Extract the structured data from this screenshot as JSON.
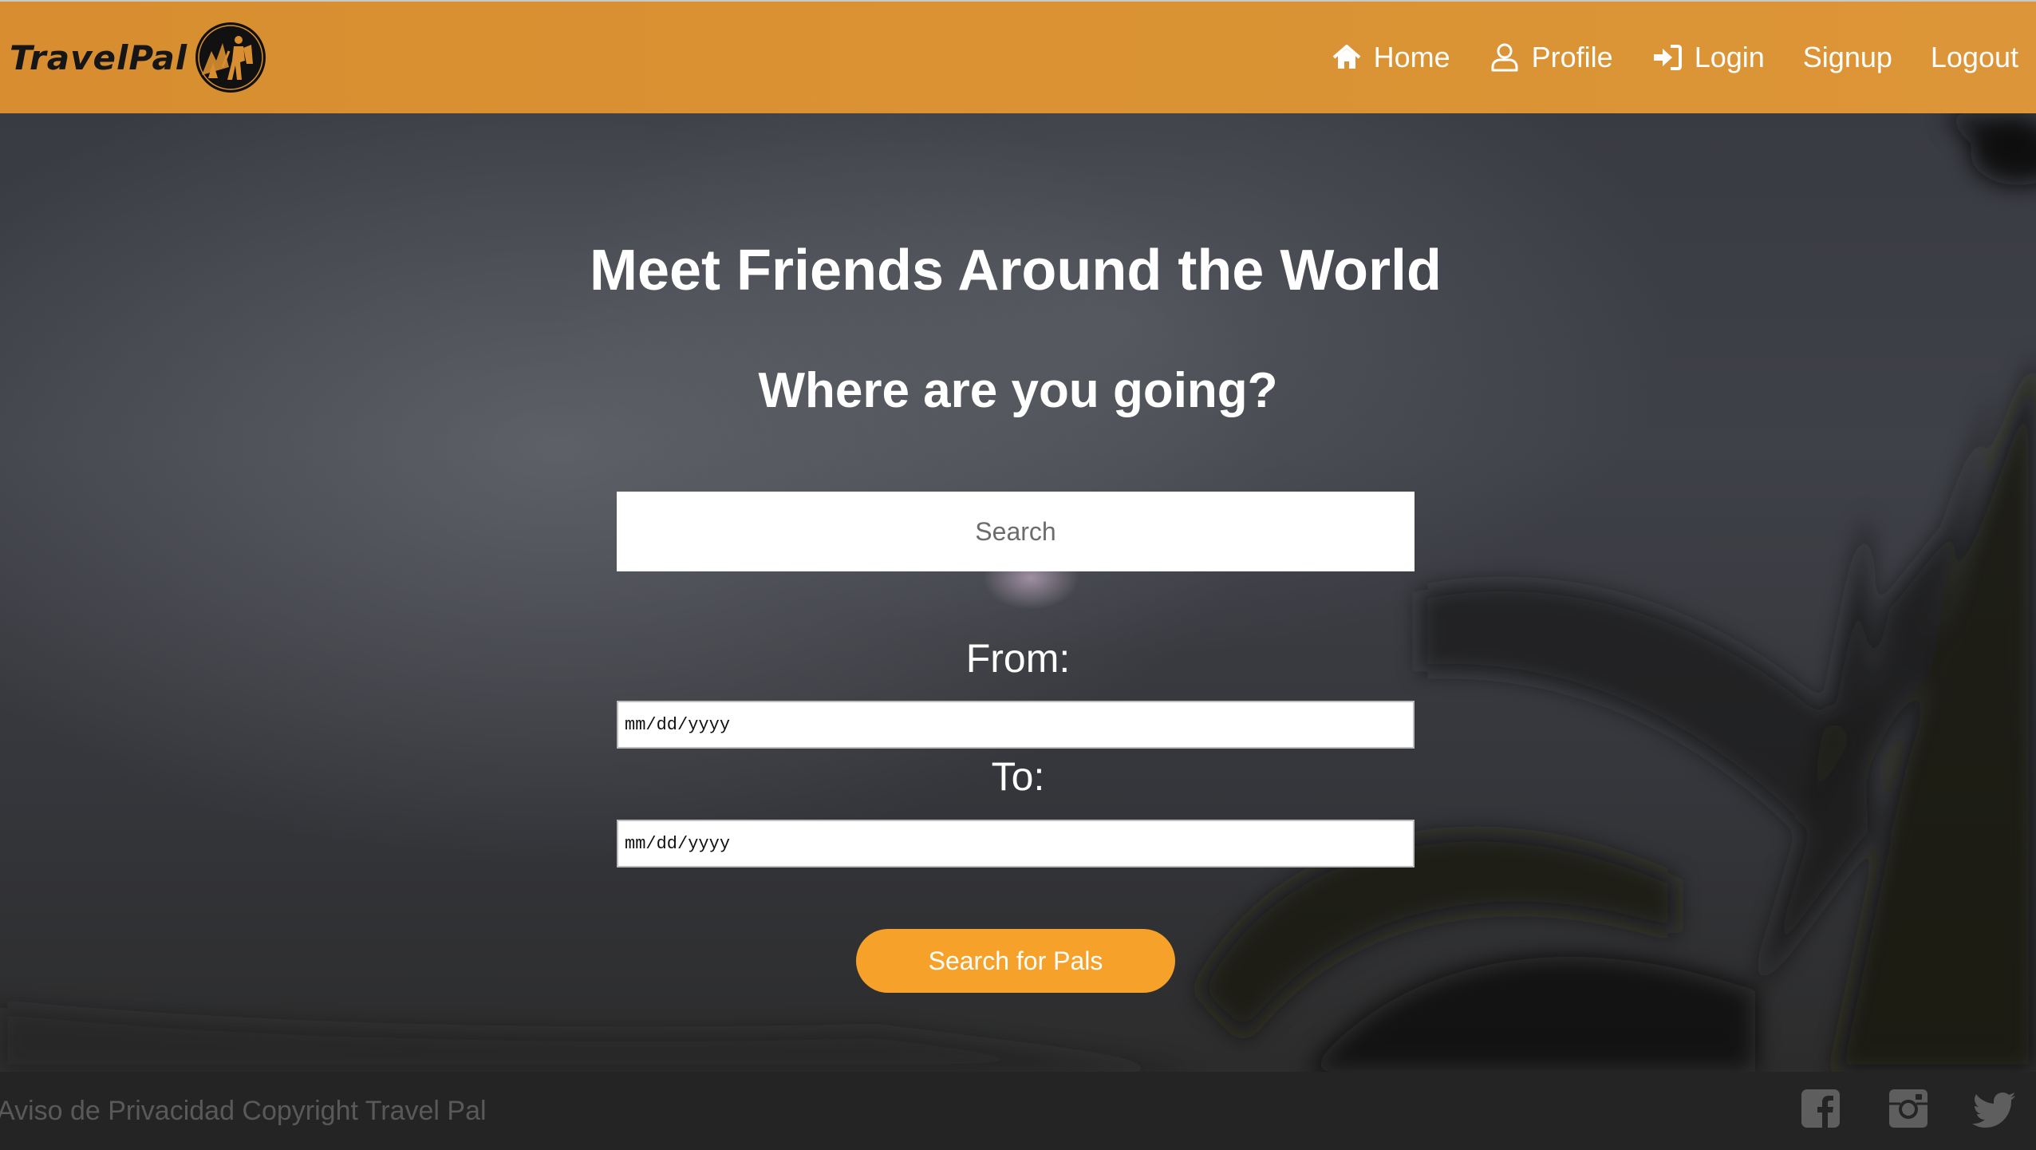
{
  "brand": {
    "name": "TravelPal",
    "logo_icon": "hiker-in-circle-logo"
  },
  "nav": {
    "items": [
      {
        "label": "Home",
        "icon": "home-icon"
      },
      {
        "label": "Profile",
        "icon": "user-icon"
      },
      {
        "label": "Login",
        "icon": "sign-in-icon"
      },
      {
        "label": "Signup",
        "icon": ""
      },
      {
        "label": "Logout",
        "icon": ""
      }
    ]
  },
  "hero": {
    "headline": "Meet Friends Around the World",
    "subheadline": "Where are you going?",
    "search": {
      "placeholder": "Search",
      "value": ""
    },
    "from_label": "From:",
    "from_value": "mm/dd/yyyy",
    "to_label": "To:",
    "to_value": "mm/dd/yyyy",
    "submit_label": "Search for Pals"
  },
  "footer": {
    "text": "Aviso de Privacidad Copyright Travel Pal",
    "social": [
      "facebook-icon",
      "instagram-icon",
      "twitter-icon"
    ]
  },
  "colors": {
    "navbar": "#d98f31",
    "button": "#f6a22a",
    "footer": "#242424",
    "footer_text": "#595959"
  }
}
